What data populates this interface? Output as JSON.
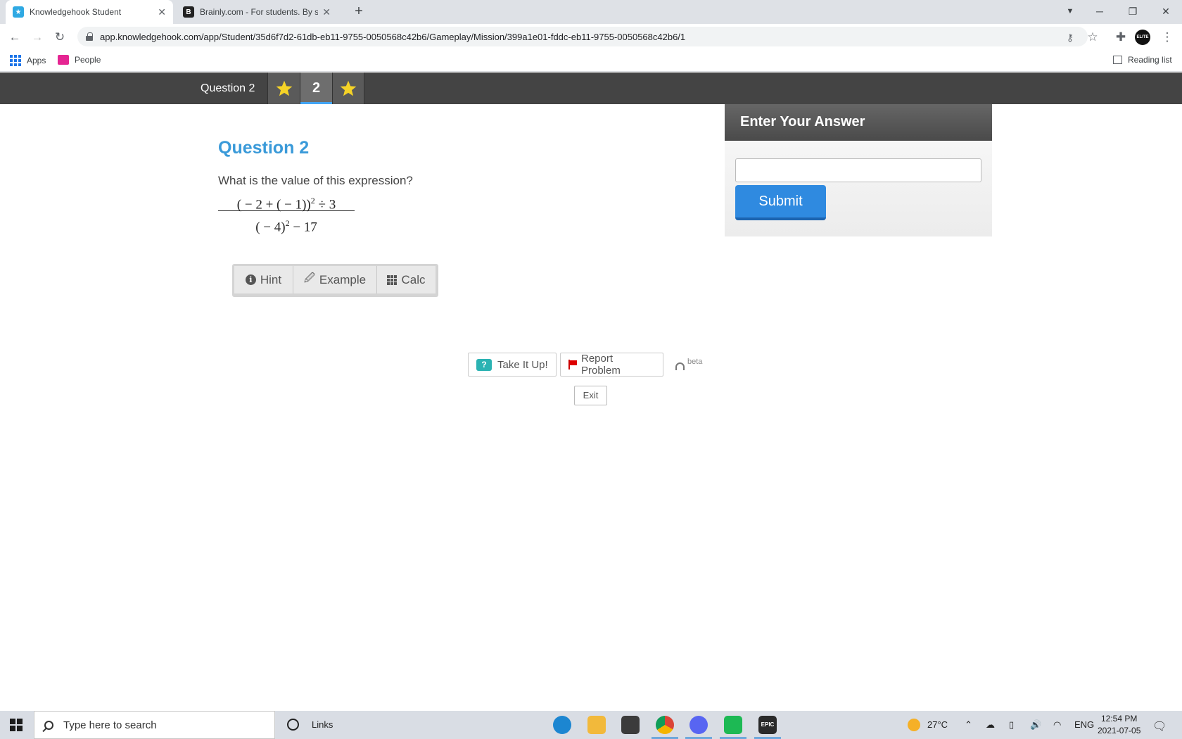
{
  "browser": {
    "tabs": [
      {
        "title": "Knowledgehook Student",
        "favicon": "knowledgehook-icon",
        "active": true
      },
      {
        "title": "Brainly.com - For students. By stu",
        "favicon": "brainly-icon",
        "active": false
      }
    ],
    "url": "app.knowledgehook.com/app/Student/35d6f7d2-61db-eb11-9755-0050568c42b6/Gameplay/Mission/399a1e01-fddc-eb11-9755-0050568c42b6/1",
    "bookmarks": [
      {
        "label": "Apps",
        "icon": "apps-grid-icon"
      },
      {
        "label": "People",
        "icon": "people-icon"
      }
    ],
    "reading_list": "Reading list",
    "profile_badge": "ELITE"
  },
  "progress_bar": {
    "question_label": "Question 2",
    "slots": [
      {
        "type": "star",
        "icon": "star-icon"
      },
      {
        "type": "number",
        "label": "2",
        "current": true
      },
      {
        "type": "star",
        "icon": "star-icon"
      }
    ],
    "star_color": "#f5d327",
    "current_underline_color": "#42a5f5"
  },
  "question": {
    "title": "Question 2",
    "prompt": "What is the value of this expression?",
    "numerator_base": "( − 2 + ( − 1))",
    "numerator_exp": "2",
    "numerator_tail": " ÷ 3",
    "denominator_base": "( − 4)",
    "denominator_exp": "2",
    "denominator_tail": " − 17"
  },
  "tools": [
    {
      "label": "Hint",
      "icon": "info-icon"
    },
    {
      "label": "Example",
      "icon": "leaf-icon"
    },
    {
      "label": "Calc",
      "icon": "calculator-grid-icon"
    }
  ],
  "answer_panel": {
    "heading": "Enter Your Answer",
    "input_value": "",
    "submit_label": "Submit",
    "accent_color": "#2f8ae0"
  },
  "actions": {
    "take_it_up": "Take It Up!",
    "take_it_up_badge": "?",
    "report_problem": "Report Problem",
    "beta": "beta",
    "exit": "Exit"
  },
  "taskbar": {
    "search_placeholder": "Type here to search",
    "links_label": "Links",
    "apps": [
      {
        "name": "edge-icon",
        "color": "#1c86d1"
      },
      {
        "name": "file-explorer-icon",
        "color": "#f2b93b"
      },
      {
        "name": "store-icon",
        "color": "#3b3b3b"
      },
      {
        "name": "chrome-icon",
        "color": "#db4437"
      },
      {
        "name": "discord-icon",
        "color": "#5865f2"
      },
      {
        "name": "spotify-icon",
        "color": "#1db954"
      },
      {
        "name": "epic-games-icon",
        "color": "#2a2a2a"
      }
    ],
    "epic_label": "EPIC",
    "weather": "27°C",
    "language": "ENG",
    "time": "12:54 PM",
    "date": "2021-07-05"
  }
}
